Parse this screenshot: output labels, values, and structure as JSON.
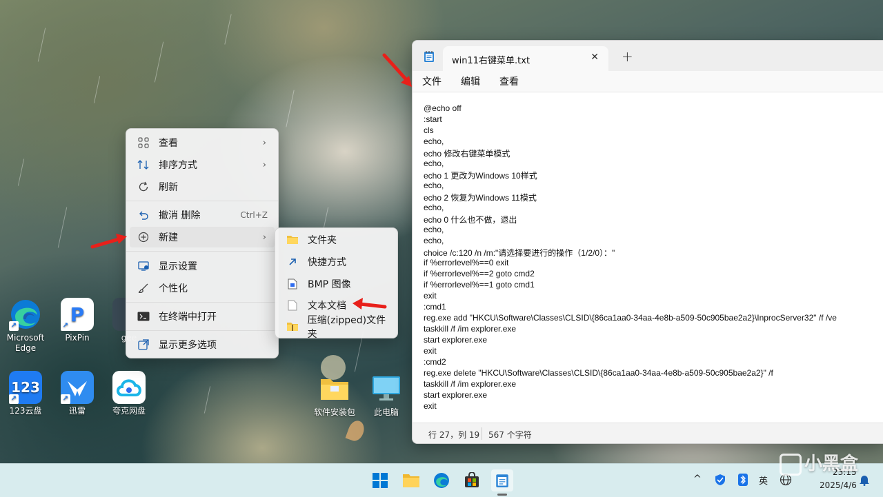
{
  "desktop": {
    "icons": [
      {
        "label_1": "Microsoft",
        "label_2": "Edge",
        "icon": "edge-icon"
      },
      {
        "label": "PixPin",
        "icon": "pixpin-icon",
        "glyph": "P"
      },
      {
        "label": "gee",
        "icon": "app-icon"
      },
      {
        "label": "123云盘",
        "icon": "123pan-icon",
        "glyph": "123"
      },
      {
        "label": "迅雷",
        "icon": "xunlei-icon"
      },
      {
        "label": "夸克网盘",
        "icon": "quark-icon"
      },
      {
        "label": "软件安装包",
        "icon": "folder-icon"
      },
      {
        "label": "此电脑",
        "icon": "computer-icon"
      }
    ]
  },
  "context_menu": {
    "items": [
      {
        "label": "查看",
        "icon": "grid-icon",
        "has_submenu": true
      },
      {
        "label": "排序方式",
        "icon": "sort-icon",
        "has_submenu": true
      },
      {
        "label": "刷新",
        "icon": "refresh-icon"
      },
      {
        "label": "撤消 删除",
        "icon": "undo-icon",
        "shortcut": "Ctrl+Z"
      },
      {
        "label": "新建",
        "icon": "plus-circle-icon",
        "has_submenu": true,
        "highlighted": true
      },
      {
        "label": "显示设置",
        "icon": "display-icon"
      },
      {
        "label": "个性化",
        "icon": "brush-icon"
      },
      {
        "label": "在终端中打开",
        "icon": "terminal-icon"
      },
      {
        "label": "显示更多选项",
        "icon": "more-options-icon"
      }
    ]
  },
  "submenu": {
    "items": [
      {
        "label": "文件夹",
        "icon": "folder-icon"
      },
      {
        "label": "快捷方式",
        "icon": "shortcut-icon"
      },
      {
        "label": "BMP 图像",
        "icon": "bmp-icon"
      },
      {
        "label": "文本文档",
        "icon": "text-document-icon"
      },
      {
        "label": "压缩(zipped)文件夹",
        "icon": "zip-folder-icon"
      }
    ]
  },
  "notepad": {
    "tab_title": "win11右键菜单.txt",
    "new_tab": "+",
    "close": "✕",
    "menu": [
      "文件",
      "编辑",
      "查看"
    ],
    "lines": [
      "@echo off",
      ":start",
      "cls",
      "echo,",
      "echo 修改右键菜单模式",
      "echo,",
      "echo 1 更改为Windows 10样式",
      "echo,",
      "echo 2 恢复为Windows 11模式",
      "echo,",
      "echo 0 什么也不做，退出",
      "echo,",
      "echo,",
      "choice /c:120 /n /m:\"请选择要进行的操作（1/2/0）：\"",
      "if %errorlevel%==0 exit",
      "if %errorlevel%==2 goto cmd2",
      "if %errorlevel%==1 goto cmd1",
      "exit",
      ":cmd1",
      "reg.exe add \"HKCU\\Software\\Classes\\CLSID\\{86ca1aa0-34aa-4e8b-a509-50c905bae2a2}\\InprocServer32\" /f /ve",
      "taskkill /f /im explorer.exe",
      "start explorer.exe",
      "exit",
      ":cmd2",
      "reg.exe delete \"HKCU\\Software\\Classes\\CLSID\\{86ca1aa0-34aa-4e8b-a509-50c905bae2a2}\" /f",
      "taskkill /f /im explorer.exe",
      "start explorer.exe",
      "exit"
    ],
    "status": {
      "position": "行 27，列 19",
      "chars": "567 个字符"
    }
  },
  "taskbar": {
    "apps": [
      "start-icon",
      "file-explorer-icon",
      "edge-icon",
      "store-icon",
      "notepad-icon"
    ],
    "tray": {
      "ime": "英",
      "time": "23:15",
      "date": "2025/4/6"
    }
  },
  "watermark": "小黑盒",
  "colors": {
    "accent": "#0067c0",
    "arrow": "#e8201a"
  }
}
